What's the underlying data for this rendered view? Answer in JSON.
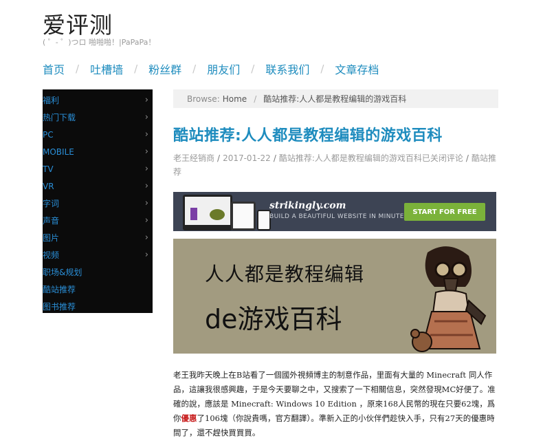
{
  "site": {
    "title": "爱评测",
    "tagline": "( ゜- ゜)つロ 啪啪啪！|PaPaPa！"
  },
  "nav": {
    "items": [
      "首页",
      "吐槽墙",
      "粉丝群",
      "朋友们",
      "联系我们",
      "文章存档"
    ]
  },
  "sidebar": {
    "items": [
      {
        "label": "福利",
        "has_arrow": true
      },
      {
        "label": "热门下载",
        "has_arrow": true
      },
      {
        "label": "PC",
        "has_arrow": true
      },
      {
        "label": "MOBILE",
        "has_arrow": true
      },
      {
        "label": "TV",
        "has_arrow": true
      },
      {
        "label": "VR",
        "has_arrow": true
      },
      {
        "label": "字词",
        "has_arrow": true
      },
      {
        "label": "声音",
        "has_arrow": true
      },
      {
        "label": "图片",
        "has_arrow": true
      },
      {
        "label": "视频",
        "has_arrow": true
      },
      {
        "label": "职场&规划",
        "has_arrow": false
      },
      {
        "label": "酷站推荐",
        "has_arrow": false
      },
      {
        "label": "图书推荐",
        "has_arrow": false
      }
    ]
  },
  "breadcrumb": {
    "browse": "Browse:",
    "home": "Home",
    "separator": "/",
    "current": "酷站推荐:人人都是教程编辑的游戏百科"
  },
  "post": {
    "title": "酷站推荐:人人都是教程编辑的游戏百科",
    "meta": {
      "author": "老王经销商",
      "date": "2017-01-22",
      "comments": "酷站推荐:人人都是教程编辑的游戏百科已关闭评论",
      "category": "酷站推荐",
      "separator": "/"
    }
  },
  "banner": {
    "brand": "strikingly.com",
    "subtitle": "BUILD A BEAUTIFUL WEBSITE IN MINUTES.",
    "cta": "START FOR FREE"
  },
  "feature": {
    "line1": "人人都是教程编辑",
    "line2": "de游戏百科"
  },
  "article": {
    "part1": "老王我昨天晚上在B站看了一個國外視頻博主的制意作品，里面有大量的 Minecraft 同人作品，這讓我很感興趣，于是今天要聊之中，又搜索了一下相關信息，突然發現MC好便了。准確的說，應該是 Minecraft: Windows 10 Edition ，原來168人民幣的現在只要62塊，爲你",
    "highlight": "優惠",
    "part2": "了106塊（你說貴嗎，官方翻譯）。準新入正的小伙伴們趁快入手，只有27天的優惠時間了，還不趕快買買買。"
  },
  "colors": {
    "accent": "#1e8cbe",
    "sidebar_bg": "#0b0b0b",
    "cta_green": "#7bb23a",
    "feature_bg": "#a29b80"
  }
}
